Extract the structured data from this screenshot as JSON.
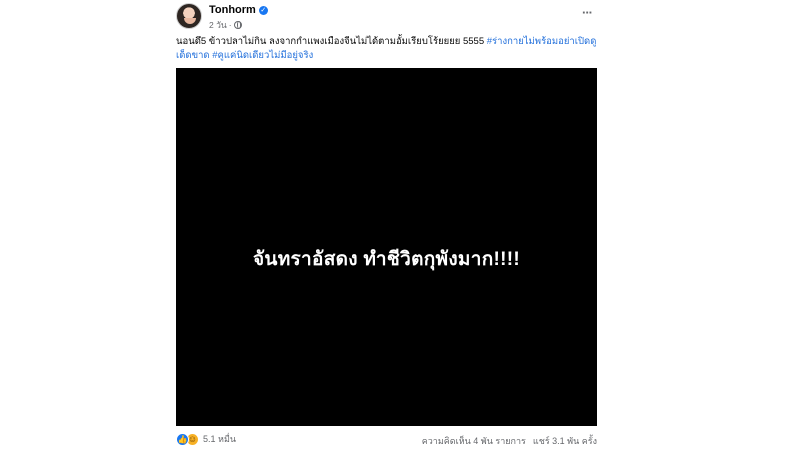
{
  "post": {
    "author": "Tonhorm",
    "timestamp": "2 วัน",
    "caption_text": "นอนดึ5 ข้าวปลาไม่กิน ลงจากกำแพงเมืองจีนไม่ได้ตามอั้มเรียบโร้ยยยย 5555 ",
    "hashtags": [
      "#ร่างกายไม่พร้อมอย่าเปิดดูเด็ดขาด",
      "#คูแค่นิดเดียวไม่มีอยู่จริง"
    ],
    "media_text": "จันทราอัสดง ทำชีวิตกุพังมาก!!!!",
    "reaction_count": "5.1 หมื่น",
    "comments": "ความคิดเห็น 4 พัน รายการ",
    "shares": "แชร์ 3.1 พัน ครั้ง"
  },
  "icons": {
    "verified": "verified-badge-icon",
    "privacy": "globe-icon",
    "more": "more-options-icon",
    "like": "like-reaction-icon",
    "haha": "haha-reaction-icon"
  },
  "colors": {
    "accent": "#1877f2",
    "hashtag": "#216fdb",
    "secondary_text": "#65676b",
    "media_background": "#000000"
  }
}
